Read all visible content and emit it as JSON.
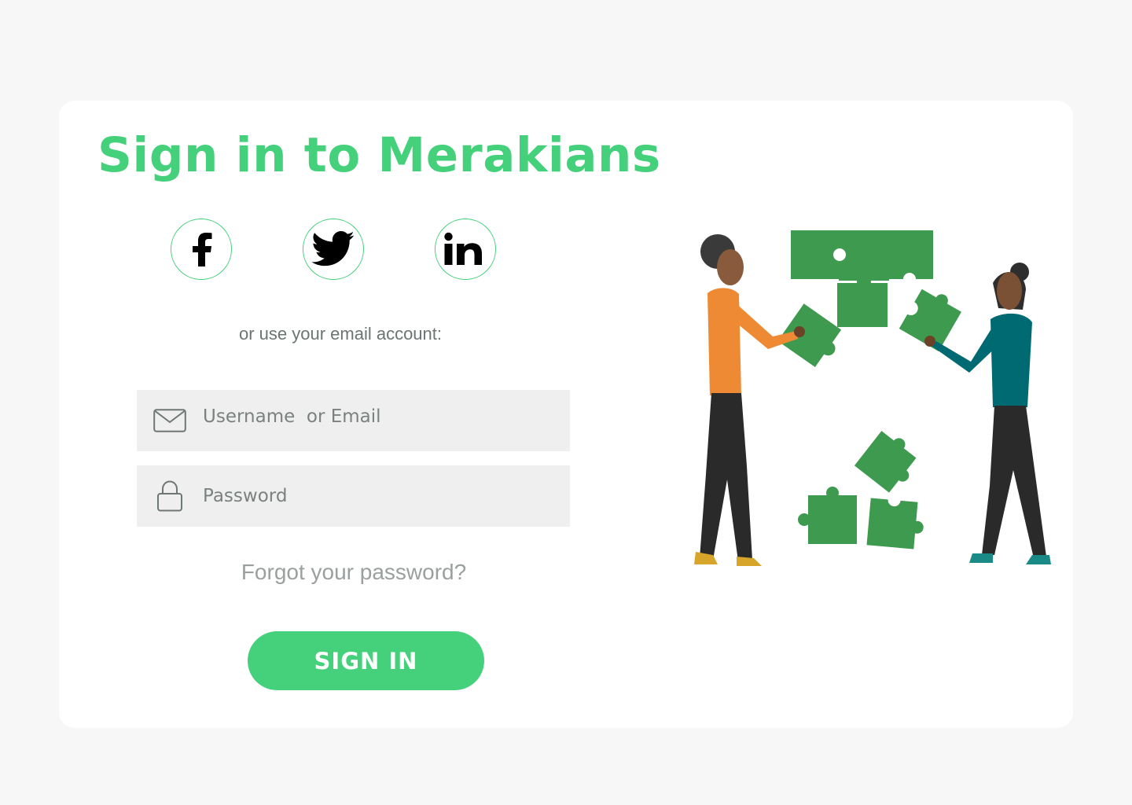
{
  "header": {
    "title": "Sign in to Merakians"
  },
  "social": [
    {
      "name": "facebook",
      "icon": "facebook-icon"
    },
    {
      "name": "twitter",
      "icon": "twitter-icon"
    },
    {
      "name": "linkedin",
      "icon": "linkedin-icon"
    }
  ],
  "form": {
    "or_text": "or use your email account:",
    "username": {
      "placeholder": "Username  or Email",
      "value": "",
      "icon": "mail-icon"
    },
    "password": {
      "placeholder": "Password",
      "value": "",
      "icon": "lock-icon"
    },
    "forgot_label": "Forgot your password?",
    "submit_label": "SIGN IN"
  },
  "illustration": {
    "description_icon": "people-assembling-puzzle-illustration"
  },
  "colors": {
    "accent": "#45d07b",
    "background": "#f7f7f7",
    "card": "#ffffff",
    "field": "#efefef",
    "muted_text": "#6b7572",
    "forgot_text": "#9aa09e",
    "puzzle": "#3d9a4f",
    "shirt_orange": "#ee8a33",
    "shirt_teal": "#006a72"
  }
}
